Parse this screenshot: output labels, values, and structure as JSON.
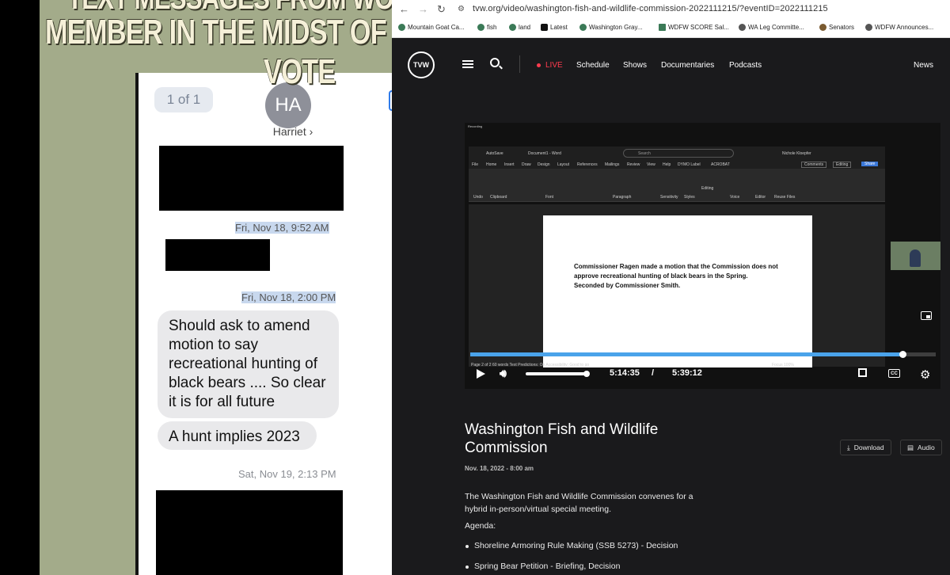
{
  "overlay": {
    "headline_line1": "TEXT MESSAGES FROM WOLF HA",
    "headline_line2": "MEMBER IN THE MIDST OF SPRING",
    "headline_line3": "VOTE"
  },
  "phone": {
    "message_counter": "1 of 1",
    "contact_initials": "HA",
    "contact_name": "Harriet ›",
    "timestamps": [
      "Fri, Nov 18, 9:52 AM",
      "Fri, Nov 18, 2:00 PM",
      "Sat, Nov 19, 2:13 PM"
    ],
    "messages": [
      "Should ask to amend motion to say recreational hunting of black bears ....   So clear it is for all future",
      "A hunt implies 2023"
    ]
  },
  "browser": {
    "url": "tvw.org/video/washington-fish-and-wildlife-commission-2022111215/?eventID=2022111215",
    "bookmarks": [
      "Mountain Goat Ca...",
      "fish",
      "land",
      "Latest",
      "Washington Gray...",
      "WDFW SCORE Sal...",
      "WA Leg Committe...",
      "Senators",
      "WDFW Announces..."
    ]
  },
  "site": {
    "logo": "TVW",
    "nav": {
      "live": "LIVE",
      "schedule": "Schedule",
      "shows": "Shows",
      "documentaries": "Documentaries",
      "podcasts": "Podcasts",
      "news": "News"
    }
  },
  "video": {
    "recording_label": "Recording",
    "word_app": {
      "autosave": "AutoSave",
      "doc_title": "Document1 - Word",
      "search_placeholder": "Search",
      "user": "Nichole Kloepfer",
      "tabs": [
        "File",
        "Home",
        "Insert",
        "Draw",
        "Design",
        "Layout",
        "References",
        "Mailings",
        "Review",
        "View",
        "Help",
        "DYMO Label",
        "ACROBAT"
      ],
      "comments": "Comments",
      "editing": "Editing",
      "share": "Share",
      "groups": [
        "Undo",
        "Clipboard",
        "Font",
        "Paragraph",
        "Sensitivity",
        "Styles",
        "Editing",
        "Voice",
        "Editor",
        "Reuse Files"
      ],
      "document_text": "Commissioner Ragen made a motion that the Commission does not approve recreational hunting of black bears in the Spring. Seconded by Commissioner Smith.",
      "status_left": "Page 2 of 2    60 words    Text Predictions: On    Accessibility: Good to go",
      "status_right": "Focus    100%"
    },
    "progress_fraction": 0.928,
    "volume_fraction": 1.0,
    "current_time": "5:14:35",
    "separator": "/",
    "duration": "5:39:12"
  },
  "event": {
    "title": "Washington Fish and Wildlife Commission",
    "date": "Nov. 18, 2022 - 8:00 am",
    "download_label": "Download",
    "audio_label": "Audio",
    "description": "The Washington Fish and Wildlife Commission convenes for a hybrid in-person/virtual special meeting.",
    "agenda_label": "Agenda:",
    "agenda_items": [
      "Shoreline Armoring Rule Making (SSB 5273) - Decision",
      "Spring Bear Petition - Briefing, Decision"
    ]
  },
  "colors": {
    "accent_blue": "#4aa3ea",
    "live_red": "#ff3b4e",
    "imessage_bubble": "#e9e9eb"
  }
}
